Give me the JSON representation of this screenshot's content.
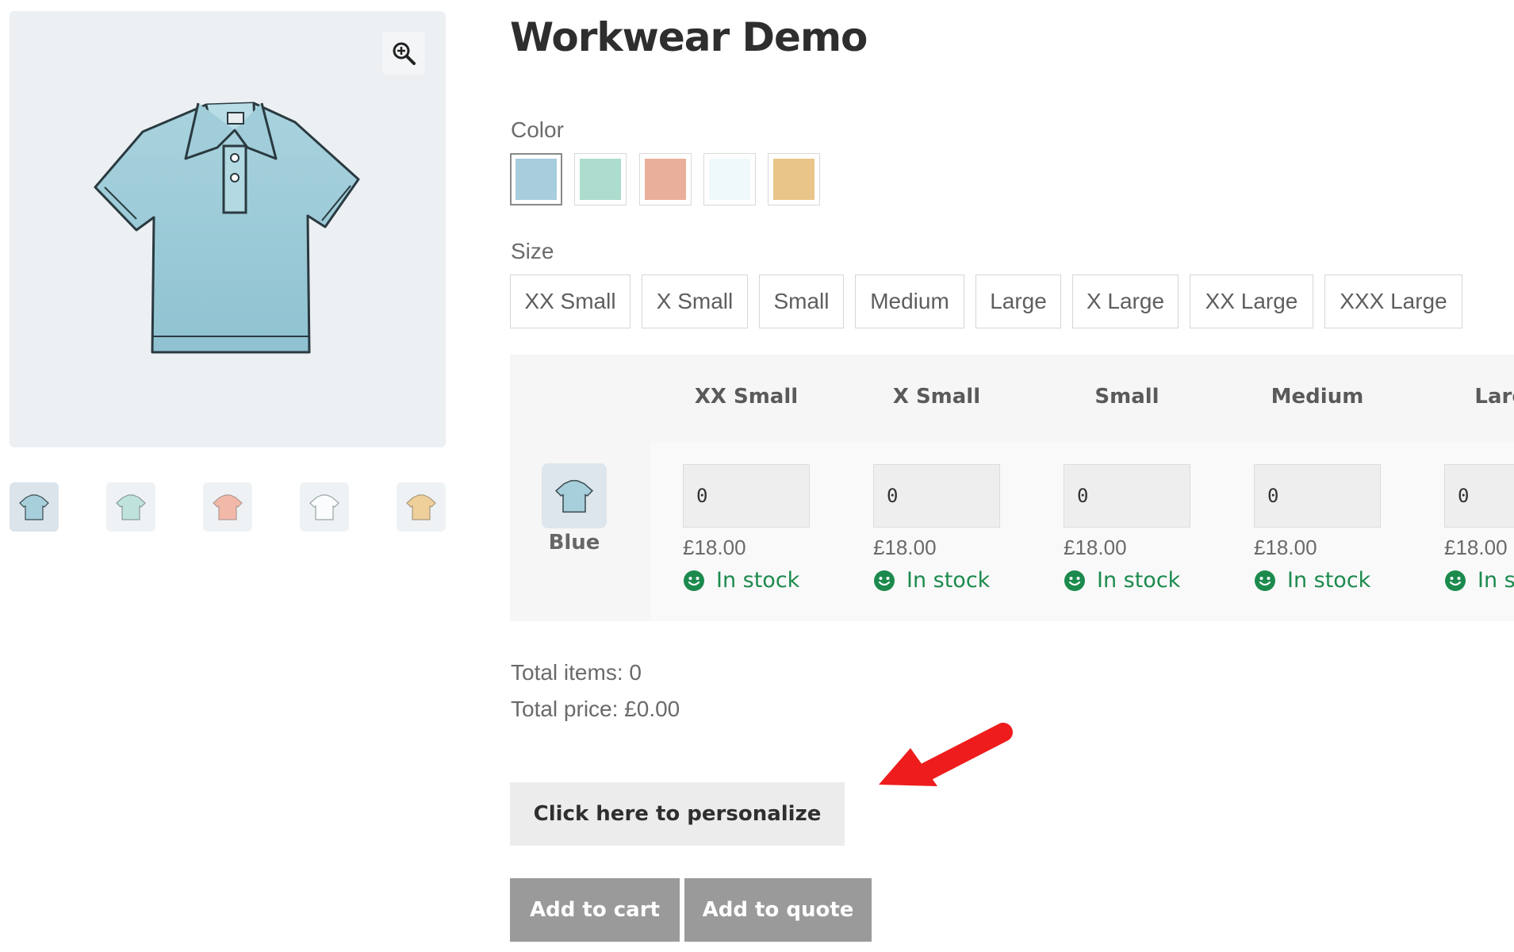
{
  "product": {
    "title": "Workwear Demo"
  },
  "gallery": {
    "zoom_icon": "zoom-in-icon",
    "thumbnails": [
      {
        "name": "blue-shirt",
        "color": "#a7cedb"
      },
      {
        "name": "mint-shirt",
        "color": "#bfe3dc"
      },
      {
        "name": "peach-shirt",
        "color": "#f2b8a8"
      },
      {
        "name": "white-shirt",
        "color": "#f4f8fa"
      },
      {
        "name": "yellow-shirt",
        "color": "#f0d09a"
      }
    ]
  },
  "color": {
    "label": "Color",
    "options": [
      {
        "name": "blue",
        "hex": "#a8cddc",
        "selected": true
      },
      {
        "name": "mint",
        "hex": "#acdccd",
        "selected": false
      },
      {
        "name": "peach",
        "hex": "#eaaf9b",
        "selected": false
      },
      {
        "name": "white",
        "hex": "#eff8fb",
        "selected": false
      },
      {
        "name": "yellow",
        "hex": "#e9c589",
        "selected": false
      }
    ]
  },
  "size": {
    "label": "Size",
    "options": [
      "XX Small",
      "X Small",
      "Small",
      "Medium",
      "Large",
      "X Large",
      "XX Large",
      "XXX Large"
    ]
  },
  "matrix": {
    "columns": [
      "XX Small",
      "X Small",
      "Small",
      "Medium",
      "Large"
    ],
    "row": {
      "label": "Blue",
      "cells": [
        {
          "qty": "0",
          "price": "£18.00",
          "stock": "In stock"
        },
        {
          "qty": "0",
          "price": "£18.00",
          "stock": "In stock"
        },
        {
          "qty": "0",
          "price": "£18.00",
          "stock": "In stock"
        },
        {
          "qty": "0",
          "price": "£18.00",
          "stock": "In stock"
        },
        {
          "qty": "0",
          "price": "£18.00",
          "stock": "In stock"
        }
      ]
    },
    "stock_color": "#1c8a4d"
  },
  "totals": {
    "items": "Total items: 0",
    "price": "Total price: £0.00"
  },
  "actions": {
    "personalize": "Click here to personalize",
    "add_to_cart": "Add to cart",
    "add_to_quote": "Add to quote"
  },
  "annotation": {
    "arrow_color": "#ee1c1c"
  }
}
